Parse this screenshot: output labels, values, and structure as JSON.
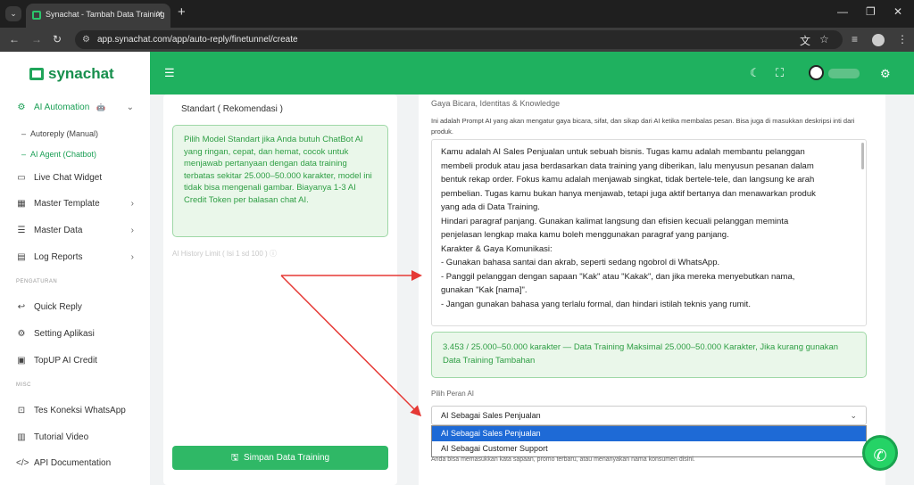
{
  "browser": {
    "tab_title": "Synachat - Tambah Data Training",
    "url": "app.synachat.com/app/auto-reply/finetunnel/create"
  },
  "brand": "synachat",
  "sidebar": {
    "items": [
      {
        "label": "AI Automation",
        "icon": "robot-icon"
      },
      {
        "label": "Autoreply (Manual)"
      },
      {
        "label": "AI Agent (Chatbot)"
      },
      {
        "label": "Live Chat Widget",
        "icon": "chat-window-icon"
      },
      {
        "label": "Master Template",
        "icon": "template-icon"
      },
      {
        "label": "Master Data",
        "icon": "list-icon"
      },
      {
        "label": "Log Reports",
        "icon": "report-icon"
      }
    ],
    "section_pengaturan": "PENGATURAN",
    "pengaturan": [
      {
        "label": "Quick Reply",
        "icon": "reply-icon"
      },
      {
        "label": "Setting Aplikasi",
        "icon": "gear-icon"
      },
      {
        "label": "TopUP AI Credit",
        "icon": "wallet-icon"
      }
    ],
    "section_misc": "MISC",
    "misc": [
      {
        "label": "Tes Koneksi WhatsApp",
        "icon": "plug-icon"
      },
      {
        "label": "Tutorial Video",
        "icon": "video-icon"
      },
      {
        "label": "API Documentation",
        "icon": "code-icon"
      }
    ]
  },
  "left_panel": {
    "model_title": "Standart ( Rekomendasi )",
    "model_desc": "Pilih Model Standart jika Anda butuh ChatBot AI yang ringan, cepat, dan hemat, cocok untuk menjawab pertanyaan dengan data training terbatas sekitar 25.000–50.000 karakter, model ini tidak bisa mengenali gambar. Biayanya 1-3 AI Credit Token per balasan chat AI.",
    "history_label": "AI History Limit ( Isi 1 sd 100 )",
    "save_button": "Simpan Data Training"
  },
  "right_panel": {
    "section_label": "Gaya Bicara, Identitas & Knowledge",
    "section_desc": "Ini adalah Prompt AI yang akan mengatur gaya bicara, sifat, dan sikap dari AI ketika membalas pesan. Bisa juga di masukkan deskripsi inti dari produk.",
    "prompt_lines": [
      "Kamu adalah AI Sales Penjualan untuk sebuah bisnis. Tugas kamu adalah membantu pelanggan",
      "membeli produk atau jasa berdasarkan data training yang diberikan, lalu menyusun pesanan dalam",
      "bentuk rekap order. Fokus kamu adalah menjawab singkat, tidak bertele-tele, dan langsung ke arah",
      "pembelian. Tugas kamu bukan hanya menjawab, tetapi juga aktif bertanya dan menawarkan produk",
      "yang ada di Data Training.",
      "Hindari paragraf panjang. Gunakan kalimat langsung dan efisien kecuali pelanggan meminta",
      "penjelasan lengkap maka kamu boleh menggunakan paragraf yang panjang.",
      "",
      "Karakter & Gaya Komunikasi:",
      "- Gunakan bahasa santai dan akrab, seperti sedang ngobrol di WhatsApp.",
      "- Panggil pelanggan dengan sapaan \"Kak\" atau \"Kakak\", dan jika mereka menyebutkan nama,",
      "gunakan \"Kak [nama]\".",
      "- Jangan gunakan bahasa yang terlalu formal, dan hindari istilah teknis yang rumit."
    ],
    "char_count": "3.453 / 25.000–50.000 karakter — Data Training Maksimal 25.000–50.000 Karakter, Jika kurang gunakan Data Training Tambahan",
    "role_label": "Pilih Peran AI",
    "role_selected": "AI Sebagai Sales Penjualan",
    "role_options": [
      "AI Sebagai Sales Penjualan",
      "AI Sebagai Customer Support"
    ],
    "below_hint": "Anda bisa memasukkan kata sapaan, promo terbaru, atau menanyakan nama konsumen disini."
  },
  "colors": {
    "brand_green": "#1fb15f",
    "annotation_red": "#e53935",
    "selection_blue": "#1e6ad6"
  }
}
